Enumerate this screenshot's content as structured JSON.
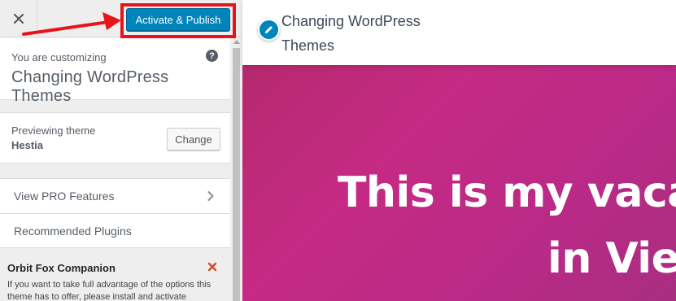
{
  "toolbar": {
    "close_icon": "close-icon",
    "publish_label": "Activate & Publish"
  },
  "info": {
    "label": "You are customizing",
    "title": "Changing WordPress Themes",
    "help_icon": "?"
  },
  "theme": {
    "label": "Previewing theme",
    "name": "Hestia",
    "change_label": "Change"
  },
  "sections": [
    {
      "label": "View PRO Features",
      "icon": "chevron-right-icon"
    },
    {
      "label": "Recommended Plugins"
    }
  ],
  "notice": {
    "title": "Orbit Fox Companion",
    "text": "If you want to take full advantage of the options this theme has to offer, please install and activate",
    "close_icon": "close-icon"
  },
  "preview": {
    "site_title": "Changing WordPress Themes",
    "hero_line1": "This is my vacatio",
    "hero_line2": "in Vietn"
  },
  "colors": {
    "publish": "#0085ba",
    "highlight": "#e8141a",
    "hero": "#c52a84",
    "notice_close": "#d54e21"
  }
}
